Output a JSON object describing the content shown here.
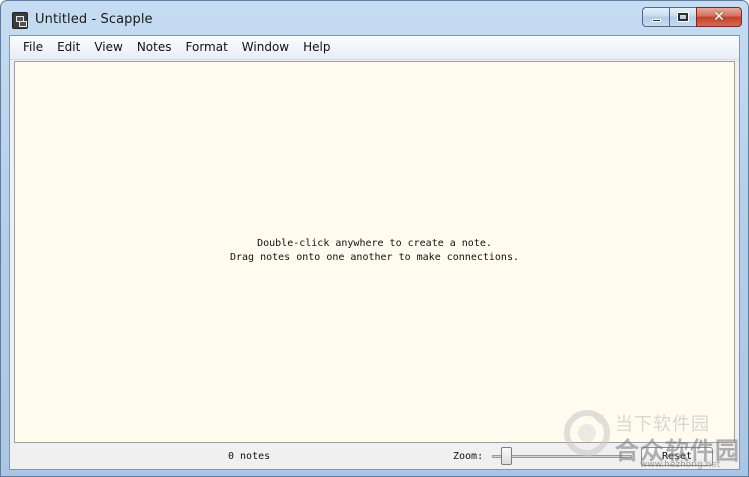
{
  "window": {
    "title": "Untitled - Scapple",
    "icon": "scapple-app-icon",
    "controls": {
      "minimize": "minimize-icon",
      "maximize": "maximize-icon",
      "close_glyph": "✕"
    }
  },
  "menubar": {
    "items": [
      "File",
      "Edit",
      "View",
      "Notes",
      "Format",
      "Window",
      "Help"
    ]
  },
  "canvas": {
    "background": "#fffbee",
    "hint_line1": "Double-click anywhere to create a note.",
    "hint_line2": "Drag notes onto one another to make connections."
  },
  "statusbar": {
    "note_count": "0 notes",
    "zoom_label": "Zoom:",
    "reset_label": "Reset"
  },
  "watermark": {
    "line1": "当下软件园",
    "line2": "合众软件园",
    "url": "www.hezhong.net"
  }
}
